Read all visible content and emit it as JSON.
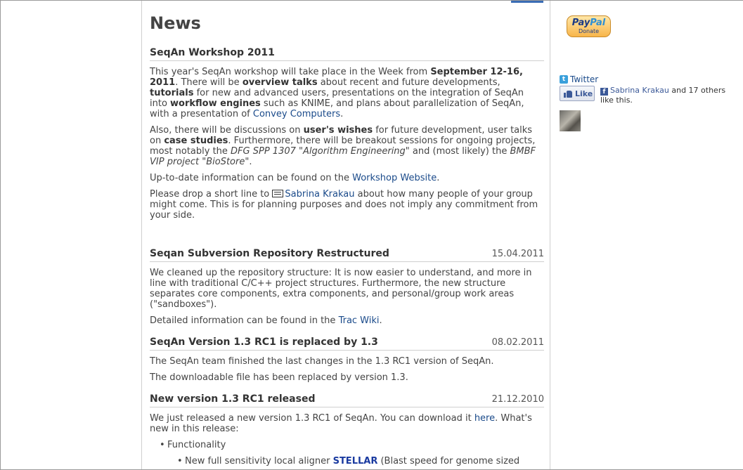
{
  "main": {
    "page_title": "News",
    "items": [
      {
        "title": "SeqAn Workshop 2011",
        "date": "",
        "p1": {
          "t1": "This year's SeqAn workshop will take place in the Week from ",
          "b1": "September 12-16, 2011",
          "t2": ". There will be ",
          "b2": "overview talks",
          "t3": " about recent and future developments, ",
          "b3": "tutorials",
          "t4": " for new and advanced users, presentations on the integration of SeqAn into ",
          "b4": "workflow engines",
          "t5": " such as KNIME, and plans about parallelization of SeqAn, with a presentation of ",
          "link": "Convey Computers",
          "t6": "."
        },
        "p2": {
          "t1": "Also, there will be discussions on ",
          "b1": "user's wishes",
          "t2": " for future development, user talks on ",
          "b2": "case studies",
          "t3": ". Furthermore, there will be breakout sessions for ongoing projects, most notably the ",
          "i1": "DFG SPP 1307 \"Algorithm Engineering\"",
          "t4": " and (most likely) the ",
          "i2": "BMBF VIP project \"BioStore\"",
          "t5": "."
        },
        "p3": {
          "t1": "Up-to-date information can be found on the ",
          "link": "Workshop Website",
          "t2": "."
        },
        "p4": {
          "t1": "Please drop a short line to ",
          "link": "Sabrina Krakau",
          "t2": " about how many people of your group might come. This is for planning purposes and does not imply any commitment from your side."
        }
      },
      {
        "title": "Seqan Subversion Repository Restructured",
        "date": "15.04.2011",
        "p1": "We cleaned up the repository structure: It is now easier to understand, and more in line with traditional C/C++ project structures. Furthermore, the new structure separates core components, extra components, and personal/group work areas (\"sandboxes\").",
        "p2": {
          "t1": "Detailed information can be found in the ",
          "link": "Trac Wiki",
          "t2": "."
        }
      },
      {
        "title": "SeqAn Version 1.3 RC1 is replaced by 1.3",
        "date": "08.02.2011",
        "p1": "The SeqAn team finished the last changes in the 1.3 RC1 version of SeqAn.",
        "p2": "The downloadable file has been replaced by version 1.3."
      },
      {
        "title": "New version 1.3 RC1 released",
        "date": "21.12.2010",
        "p1": {
          "t1": "We just released a new version 1.3 RC1 of SeqAn. You can download it ",
          "link": "here",
          "t2": ". What's new in this release:"
        },
        "list_item": "Functionality",
        "sub_item": {
          "t1": "New full sensitivity local aligner ",
          "b1": "STELLAR",
          "t2": " (Blast speed for genome sized"
        }
      }
    ]
  },
  "sidebar": {
    "paypal": {
      "word1": "Pay",
      "word2": "Pal",
      "donate": "Donate"
    },
    "twitter_label": "Twitter",
    "like_label": "Like",
    "fb_name": "Sabrina Krakau",
    "fb_text": " and 17 others like this.",
    "colors": {
      "facebook": "#3b5998",
      "twitter": "#3aa0db",
      "link": "#1a4a8a"
    }
  }
}
